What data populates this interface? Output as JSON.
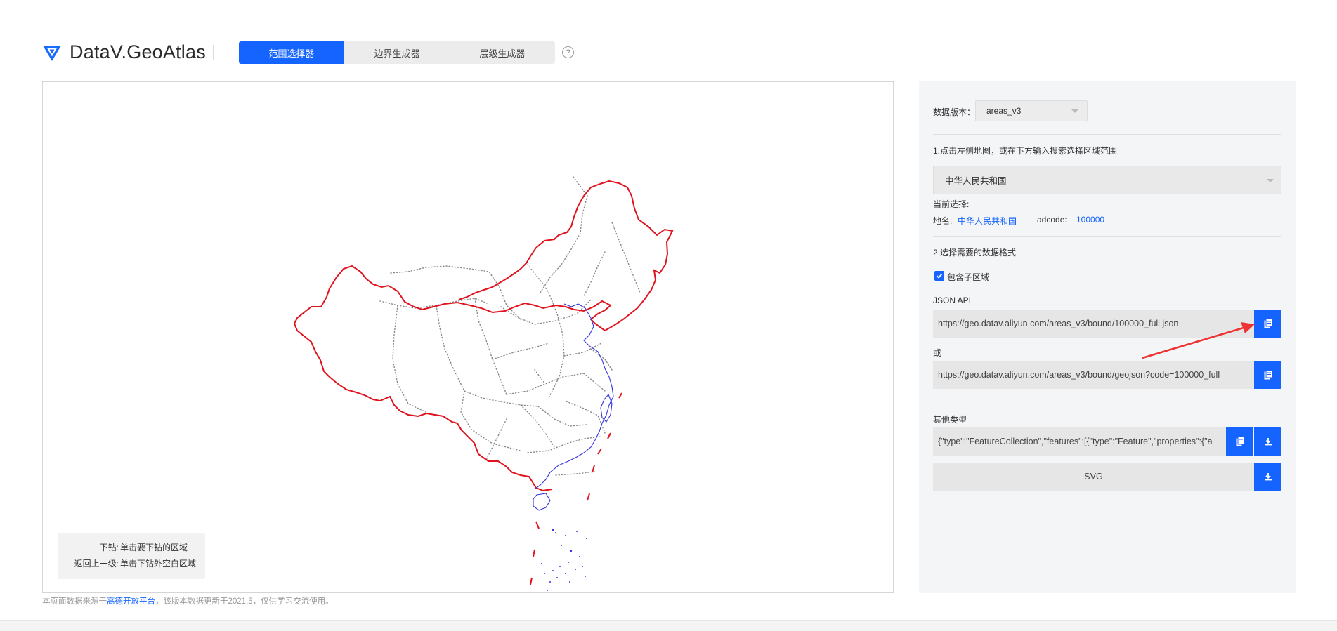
{
  "header": {
    "logo_text": "DataV.GeoAtlas",
    "tabs": [
      {
        "label": "范围选择器",
        "active": true
      },
      {
        "label": "边界生成器",
        "active": false
      },
      {
        "label": "层级生成器",
        "active": false
      }
    ],
    "help_glyph": "?"
  },
  "map": {
    "hint": [
      {
        "key": "下钻:",
        "value": "单击要下钻的区域"
      },
      {
        "key": "返回上一级:",
        "value": "单击下钻外空白区域"
      }
    ],
    "outline_color": "#e0141e",
    "coast_color": "#2b2bd6"
  },
  "footnote": {
    "prefix": "本页面数据来源于",
    "link": "高德开放平台",
    "suffix": "，该版本数据更新于2021.5，仅供学习交流使用。"
  },
  "side": {
    "version_label": "数据版本：",
    "version_value": "areas_v3",
    "step1": "1.点击左侧地图，或在下方输入搜索选择区域范围",
    "region_select": "中华人民共和国",
    "current_label": "当前选择:",
    "name_label": "地名:",
    "name_value": "中华人民共和国",
    "adcode_label": "adcode:",
    "adcode_value": "100000",
    "step2": "2.选择需要的数据格式",
    "include_children": "包含子区域",
    "include_children_checked": true,
    "json_api_label": "JSON API",
    "json_api_url": "https://geo.datav.aliyun.com/areas_v3/bound/100000_full.json",
    "or_label": "或",
    "geojson_url": "https://geo.datav.aliyun.com/areas_v3/bound/geojson?code=100000_full",
    "other_label": "其他类型",
    "other_value": "{\"type\":\"FeatureCollection\",\"features\":[{\"type\":\"Feature\",\"properties\":{\"a",
    "svg_label": "SVG"
  },
  "colors": {
    "accent": "#1664ff",
    "annotation_arrow": "#ee3333"
  }
}
